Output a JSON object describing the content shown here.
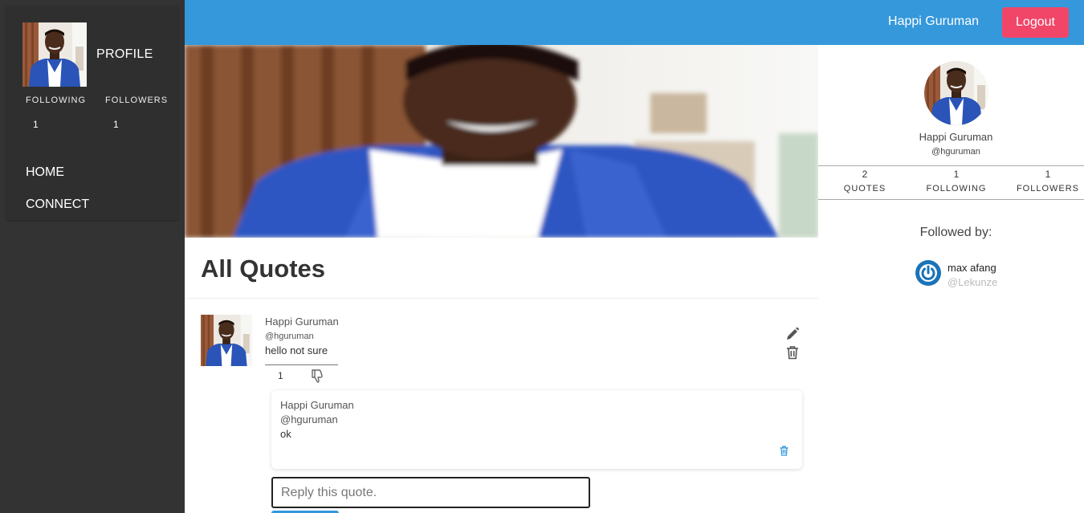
{
  "sidebar": {
    "profile_label": "PROFILE",
    "following_label": "FOLLOWING",
    "followers_label": "FOLLOWERS",
    "following_count": "1",
    "followers_count": "1",
    "nav": [
      {
        "label": "HOME"
      },
      {
        "label": "CONNECT"
      }
    ]
  },
  "topbar": {
    "user_name": "Happi Guruman",
    "logout_label": "Logout",
    "bar_color": "#3498db",
    "logout_color": "#f14668"
  },
  "main": {
    "title": "All Quotes",
    "quotes": [
      {
        "author_name": "Happi Guruman",
        "author_handle": "@hguruman",
        "text": "hello not sure",
        "likes": "1",
        "replies": [
          {
            "author_name": "Happi Guruman",
            "author_handle": "@hguruman",
            "text": "ok"
          }
        ]
      }
    ],
    "reply_placeholder": "Reply this quote."
  },
  "right_panel": {
    "name": "Happi Guruman",
    "handle": "@hguruman",
    "stats": [
      {
        "value": "2",
        "label": "QUOTES"
      },
      {
        "value": "1",
        "label": "FOLLOWING"
      },
      {
        "value": "1",
        "label": "FOLLOWERS"
      }
    ],
    "followed_by_label": "Followed by:",
    "followers": [
      {
        "name": "max afang",
        "handle": "@Lekunze",
        "icon": "power-icon"
      }
    ]
  }
}
